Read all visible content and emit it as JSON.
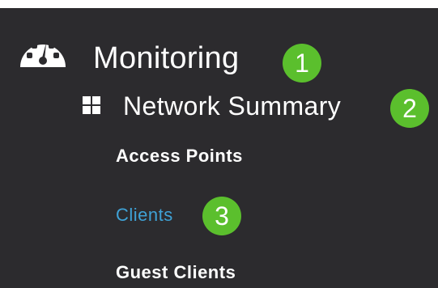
{
  "colors": {
    "panel_background": "#2c2b2e",
    "text": "#ffffff",
    "active_link": "#3fa2d6",
    "badge": "#5bbf2d"
  },
  "monitoring": {
    "icon": "dashboard-dial-icon",
    "label": "Monitoring",
    "step_badge": "1"
  },
  "network_summary": {
    "icon": "grid-icon",
    "label": "Network Summary",
    "step_badge": "2"
  },
  "submenu": {
    "items": [
      {
        "label": "Access Points"
      },
      {
        "label": "Clients",
        "step_badge": "3",
        "active": true
      },
      {
        "label": "Guest Clients"
      }
    ]
  }
}
